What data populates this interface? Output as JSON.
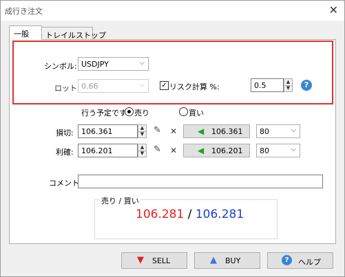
{
  "window": {
    "title": "成行き注文",
    "close_glyph": "✕"
  },
  "tabs": [
    {
      "label": "一般"
    },
    {
      "label": "トレイルストップ"
    }
  ],
  "symbol": {
    "label": "シンボル:",
    "value": "USDJPY"
  },
  "lot": {
    "label": "ロット:",
    "value": "0.66"
  },
  "risk": {
    "checkbox_label": "リスク計算 %:",
    "checked": true,
    "value": "0.5"
  },
  "order_type": {
    "prefix": "行う予定です",
    "sell_label": "売り",
    "buy_label": "買い",
    "selected": "sell"
  },
  "stop_loss": {
    "label": "損切:",
    "value": "106.361",
    "price_button": "106.361",
    "points": "80"
  },
  "take_profit": {
    "label": "利確:",
    "value": "106.201",
    "price_button": "106.201",
    "points": "80"
  },
  "comment": {
    "label": "コメント:",
    "value": ""
  },
  "quote": {
    "group_label": "売り / 買い",
    "bid": "106.281",
    "separator": " / ",
    "ask": "106.281"
  },
  "buttons": {
    "sell": "SELL",
    "buy": "BUY",
    "help": "ヘルプ"
  },
  "colors": {
    "bid": "#e02020",
    "ask": "#1a3fd0",
    "highlight_border": "#e03030",
    "arrow_green": "#22a422",
    "help_icon": "#3a86d4"
  }
}
